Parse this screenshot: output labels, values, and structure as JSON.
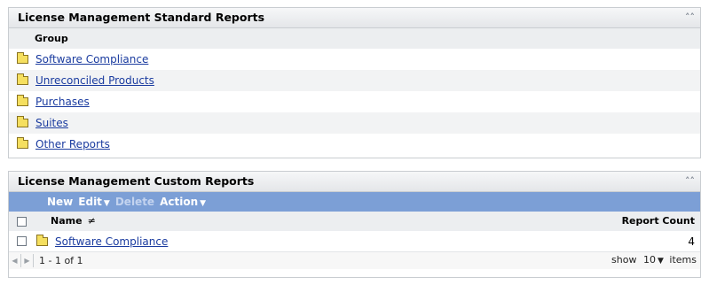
{
  "standard": {
    "title": "License Management Standard Reports",
    "column_header": "Group",
    "items": [
      {
        "label": "Software Compliance"
      },
      {
        "label": "Unreconciled Products"
      },
      {
        "label": "Purchases"
      },
      {
        "label": "Suites"
      },
      {
        "label": "Other Reports"
      }
    ]
  },
  "custom": {
    "title": "License Management Custom Reports",
    "toolbar": {
      "new": "New",
      "edit": "Edit",
      "delete": "Delete",
      "action": "Action"
    },
    "columns": {
      "name": "Name",
      "sort_indicator": "≠",
      "report_count": "Report Count"
    },
    "rows": [
      {
        "name": "Software Compliance",
        "count": "4"
      }
    ],
    "footer": {
      "page_info": "1 - 1 of 1",
      "show_label": "show",
      "show_value": "10",
      "items_label": "items"
    }
  },
  "icons": {
    "collapse": "double-chevron-up-icon",
    "folder": "folder-icon"
  }
}
